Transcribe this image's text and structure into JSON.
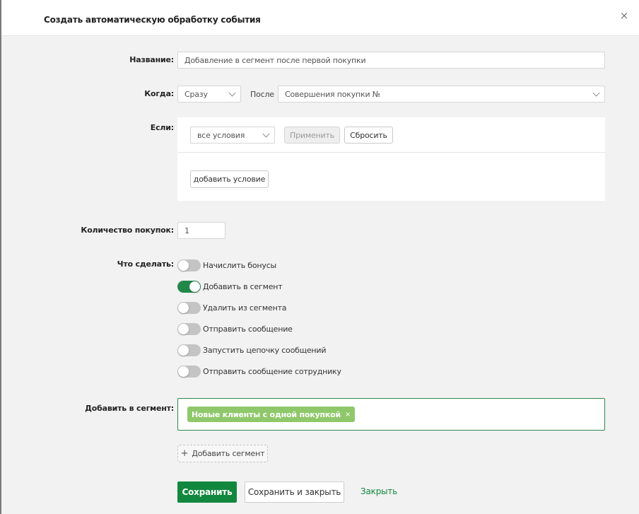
{
  "dialog": {
    "title": "Создать автоматическую обработку события",
    "close_icon": "×"
  },
  "form": {
    "name_label": "Название:",
    "name_value": "Добавление в сегмент после первой покупки",
    "when_label": "Когда:",
    "when_value": "Сразу",
    "after_label": "После",
    "after_value": "Совершения покупки №",
    "if_label": "Если:",
    "conditions_value": "все условия",
    "apply_button": "Применить",
    "reset_button": "Сбросить",
    "add_condition_button": "добавить условие",
    "purchases_label": "Количество покупок:",
    "purchases_value": "1",
    "action_label": "Что сделать:",
    "actions": [
      {
        "label": "Начислить бонусы",
        "on": false
      },
      {
        "label": "Добавить в сегмент",
        "on": true
      },
      {
        "label": "Удалить из сегмента",
        "on": false
      },
      {
        "label": "Отправить сообщение",
        "on": false
      },
      {
        "label": "Запустить цепочку сообщений",
        "on": false
      },
      {
        "label": "Отправить сообщение сотруднику",
        "on": false
      }
    ],
    "segment_label": "Добавить в сегмент:",
    "segment_tag": "Новые клиенты с одной покупкой",
    "segment_tag_remove": "×",
    "add_segment_button": "Добавить сегмент"
  },
  "footer": {
    "save": "Сохранить",
    "save_close": "Сохранить и закрыть",
    "close": "Закрыть"
  },
  "colors": {
    "primary": "#12883f",
    "toggle_on": "#22884a",
    "tag_bg": "#8fc86a"
  }
}
